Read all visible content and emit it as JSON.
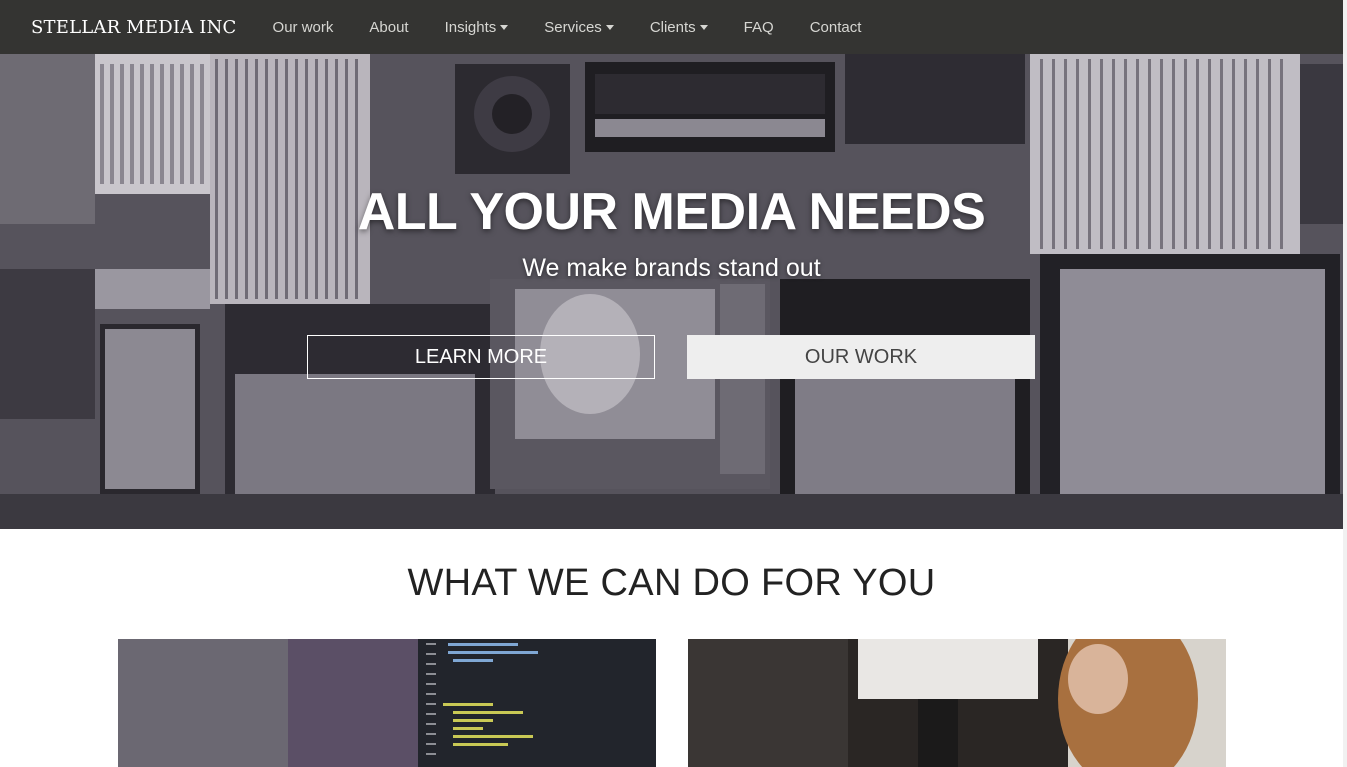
{
  "navbar": {
    "brand": "STELLAR MEDIA INC",
    "items": [
      {
        "label": "Our work",
        "dropdown": false
      },
      {
        "label": "About",
        "dropdown": false
      },
      {
        "label": "Insights",
        "dropdown": true
      },
      {
        "label": "Services",
        "dropdown": true
      },
      {
        "label": "Clients",
        "dropdown": true
      },
      {
        "label": "FAQ",
        "dropdown": false
      },
      {
        "label": "Contact",
        "dropdown": false
      }
    ]
  },
  "hero": {
    "title": "ALL YOUR MEDIA NEEDS",
    "subtitle": "We make brands stand out",
    "learn_more_label": "LEARN MORE",
    "our_work_label": "OUR WORK"
  },
  "section": {
    "title": "WHAT WE CAN DO FOR YOU",
    "cards": [
      {
        "image": "code-editor-laptop-photo"
      },
      {
        "image": "people-working-photo"
      }
    ]
  },
  "colors": {
    "navbar_bg": "#343432",
    "nav_text": "#d6d6d2",
    "hero_overlay": "#4a4850",
    "button_light": "#eeeeee"
  }
}
